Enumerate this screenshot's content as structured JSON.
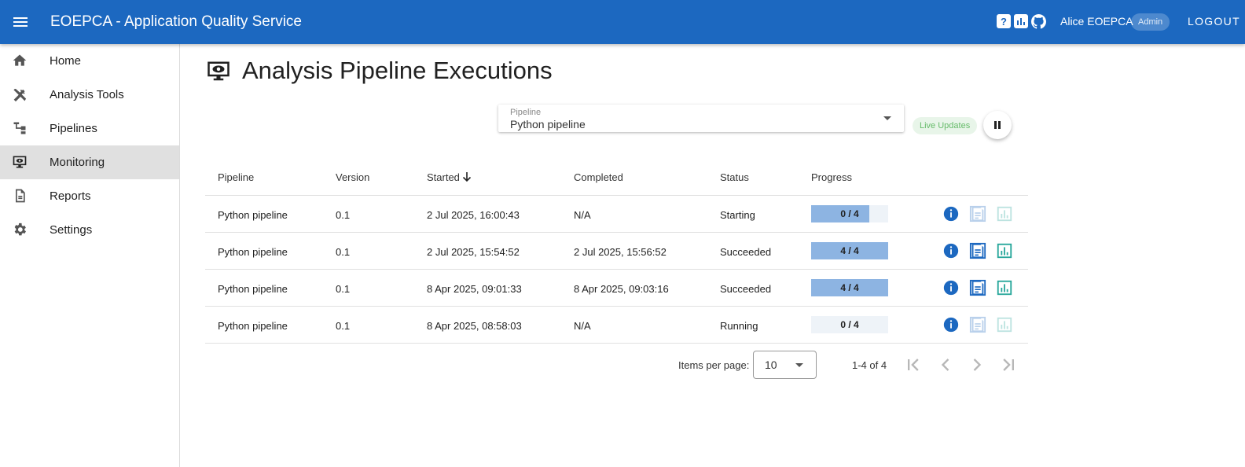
{
  "header": {
    "title": "EOEPCA - Application Quality Service",
    "help_icon": "?",
    "stats_icon": "chart-icon",
    "github_icon": "github-icon",
    "user_name": "Alice EOEPCA",
    "role_badge": "Admin",
    "logout_label": "LOGOUT",
    "color": "#1c68c0"
  },
  "sidebar": {
    "items": [
      {
        "label": "Home",
        "icon": "home-icon",
        "active": false
      },
      {
        "label": "Analysis Tools",
        "icon": "tools-icon",
        "active": false
      },
      {
        "label": "Pipelines",
        "icon": "pipeline-icon",
        "active": false
      },
      {
        "label": "Monitoring",
        "icon": "monitor-eye-icon",
        "active": true
      },
      {
        "label": "Reports",
        "icon": "report-icon",
        "active": false
      },
      {
        "label": "Settings",
        "icon": "gear-icon",
        "active": false
      }
    ]
  },
  "page": {
    "title": "Analysis Pipeline Executions",
    "icon": "monitor-eye-icon"
  },
  "filter": {
    "pipeline_label": "Pipeline",
    "pipeline_value": "Python pipeline",
    "live_updates_label": "Live Updates",
    "pause_icon": "pause-icon"
  },
  "table": {
    "headers": {
      "pipeline": "Pipeline",
      "version": "Version",
      "started": "Started",
      "completed": "Completed",
      "status": "Status",
      "progress": "Progress"
    },
    "rows": [
      {
        "pipeline": "Python pipeline",
        "version": "0.1",
        "started": "2 Jul 2025, 16:00:43",
        "completed": "N/A",
        "status": "Starting",
        "progress_text": "0 / 4",
        "progress_fraction": 0.75,
        "report_enabled": false
      },
      {
        "pipeline": "Python pipeline",
        "version": "0.1",
        "started": "2 Jul 2025, 15:54:52",
        "completed": "2 Jul 2025, 15:56:52",
        "status": "Succeeded",
        "progress_text": "4 / 4",
        "progress_fraction": 1.0,
        "report_enabled": true
      },
      {
        "pipeline": "Python pipeline",
        "version": "0.1",
        "started": "8 Apr 2025, 09:01:33",
        "completed": "8 Apr 2025, 09:03:16",
        "status": "Succeeded",
        "progress_text": "4 / 4",
        "progress_fraction": 1.0,
        "report_enabled": true
      },
      {
        "pipeline": "Python pipeline",
        "version": "0.1",
        "started": "8 Apr 2025, 08:58:03",
        "completed": "N/A",
        "status": "Running",
        "progress_text": "0 / 4",
        "progress_fraction": 0.0,
        "report_enabled": false
      }
    ]
  },
  "paginator": {
    "items_per_page_label": "Items per page:",
    "items_per_page": "10",
    "range_label": "1-4 of 4"
  }
}
